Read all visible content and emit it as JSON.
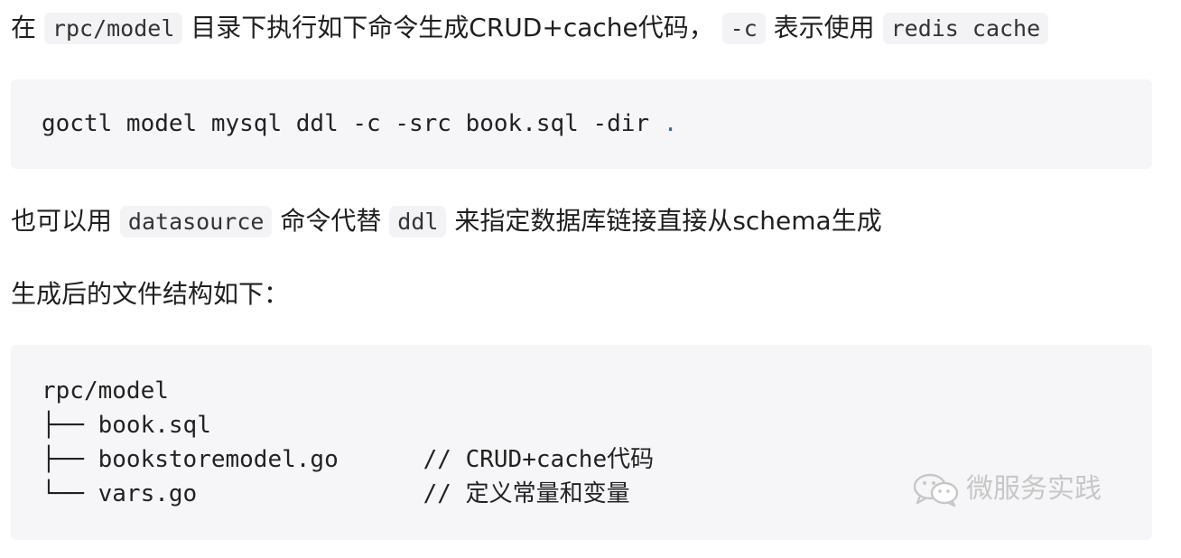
{
  "para1": {
    "t1": "在",
    "c1": "rpc/model",
    "t2": "目录下执行如下命令生成CRUD+cache代码，",
    "c2": "-c",
    "t3": "表示使用",
    "c3": "redis cache"
  },
  "code1": {
    "cmd": "goctl model mysql ddl -c -src book.sql -dir",
    "dot": "."
  },
  "para2": {
    "t1": "也可以用",
    "c1": "datasource",
    "t2": "命令代替",
    "c2": "ddl",
    "t3": "来指定数据库链接直接从schema生成"
  },
  "para3": {
    "text": "生成后的文件结构如下："
  },
  "code2": {
    "root": "rpc/model",
    "items": [
      {
        "branch": "├── ",
        "name": "book.sql",
        "comment": ""
      },
      {
        "branch": "├── ",
        "name": "bookstoremodel.go",
        "comment": "// CRUD+cache代码"
      },
      {
        "branch": "└── ",
        "name": "vars.go",
        "comment": "// 定义常量和变量"
      }
    ]
  },
  "watermark": {
    "text": "微服务实践",
    "icon": "wechat-icon"
  }
}
